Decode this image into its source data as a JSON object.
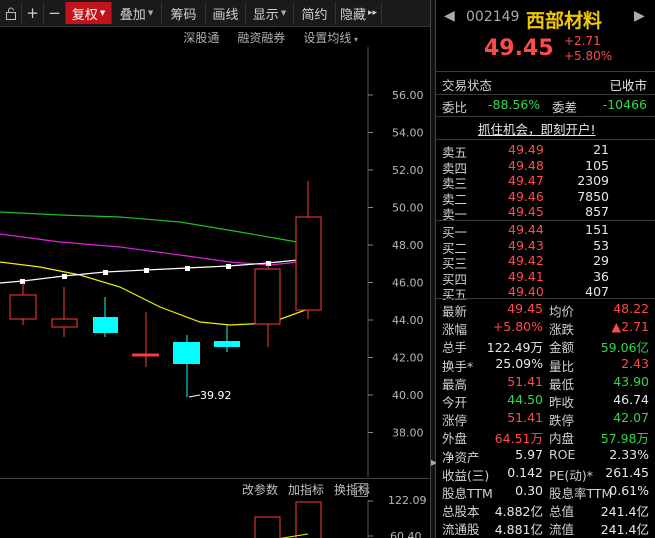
{
  "toolbar": {
    "items": [
      "复权",
      "叠加",
      "筹码",
      "画线",
      "显示",
      "简约",
      "隐藏"
    ],
    "more": "▸▸"
  },
  "subbar": [
    "深股通",
    "融资融券",
    "设置均线"
  ],
  "chart": {
    "price_labels": [
      "56.00",
      "54.00",
      "52.00",
      "50.00",
      "48.00",
      "46.00",
      "44.00",
      "42.00",
      "40.00",
      "38.00"
    ],
    "low_marker": "39.92",
    "colors": {
      "up": "#ff3b3b",
      "down": "#00ffff",
      "ma_white": "#ffffff",
      "ma_yellow": "#f0f000",
      "ma_magenta": "#e020e0",
      "ma_green": "#20c020"
    }
  },
  "indbar": {
    "items": [
      "改参数",
      "加指标",
      "换指标"
    ],
    "close": "✕"
  },
  "vol_labels": [
    "122.09",
    "60.40"
  ],
  "quote": {
    "code": "002149",
    "name": "西部材料",
    "price": "49.45",
    "change": "+2.71",
    "pct": "+5.80%",
    "status_label": "交易状态",
    "status_value": "已收市",
    "weibi_label": "委比",
    "weibi_value": "-88.56%",
    "weicha_label": "委差",
    "weicha_value": "-10466",
    "banner": "抓住机会，即刻开户!"
  },
  "asks": [
    {
      "label": "卖五",
      "price": "49.49",
      "vol": "21"
    },
    {
      "label": "卖四",
      "price": "49.48",
      "vol": "105"
    },
    {
      "label": "卖三",
      "price": "49.47",
      "vol": "2309"
    },
    {
      "label": "卖二",
      "price": "49.46",
      "vol": "7850"
    },
    {
      "label": "卖一",
      "price": "49.45",
      "vol": "857"
    }
  ],
  "bids": [
    {
      "label": "买一",
      "price": "49.44",
      "vol": "151"
    },
    {
      "label": "买二",
      "price": "49.43",
      "vol": "53"
    },
    {
      "label": "买三",
      "price": "49.42",
      "vol": "29"
    },
    {
      "label": "买四",
      "price": "49.41",
      "vol": "36"
    },
    {
      "label": "买五",
      "price": "49.40",
      "vol": "407"
    }
  ],
  "stats": [
    {
      "l1": "最新",
      "v1": "49.45",
      "c1": "red",
      "l2": "均价",
      "v2": "48.22",
      "c2": "red"
    },
    {
      "l1": "涨幅",
      "v1": "+5.80%",
      "c1": "red",
      "l2": "涨跌",
      "v2": "▲2.71",
      "c2": "red"
    },
    {
      "l1": "总手",
      "v1": "122.49万",
      "c1": "white",
      "l2": "金额",
      "v2": "59.06亿",
      "c2": "yellowgreen"
    },
    {
      "l1": "换手*",
      "v1": "25.09%",
      "c1": "white",
      "l2": "量比",
      "v2": "2.43",
      "c2": "red"
    },
    {
      "l1": "最高",
      "v1": "51.41",
      "c1": "red",
      "l2": "最低",
      "v2": "43.90",
      "c2": "green"
    },
    {
      "l1": "今开",
      "v1": "44.50",
      "c1": "green",
      "l2": "昨收",
      "v2": "46.74",
      "c2": "white"
    },
    {
      "l1": "涨停",
      "v1": "51.41",
      "c1": "red",
      "l2": "跌停",
      "v2": "42.07",
      "c2": "green"
    },
    {
      "l1": "外盘",
      "v1": "64.51万",
      "c1": "red",
      "l2": "内盘",
      "v2": "57.98万",
      "c2": "green"
    },
    {
      "l1": "净资产",
      "v1": "5.97",
      "c1": "white",
      "l2": "ROE",
      "v2": "2.33%",
      "c2": "white"
    },
    {
      "l1": "收益(三)",
      "v1": "0.142",
      "c1": "white",
      "l2": "PE(动)*",
      "v2": "261.45",
      "c2": "white"
    },
    {
      "l1": "股息TTM",
      "v1": "0.30",
      "c1": "white",
      "l2": "股息率TTM",
      "v2": "0.61%",
      "c2": "white"
    },
    {
      "l1": "总股本",
      "v1": "4.882亿",
      "c1": "white",
      "l2": "总值",
      "v2": "241.4亿",
      "c2": "white"
    },
    {
      "l1": "流通股",
      "v1": "4.881亿",
      "c1": "white",
      "l2": "流值",
      "v2": "241.4亿",
      "c2": "white"
    }
  ]
}
